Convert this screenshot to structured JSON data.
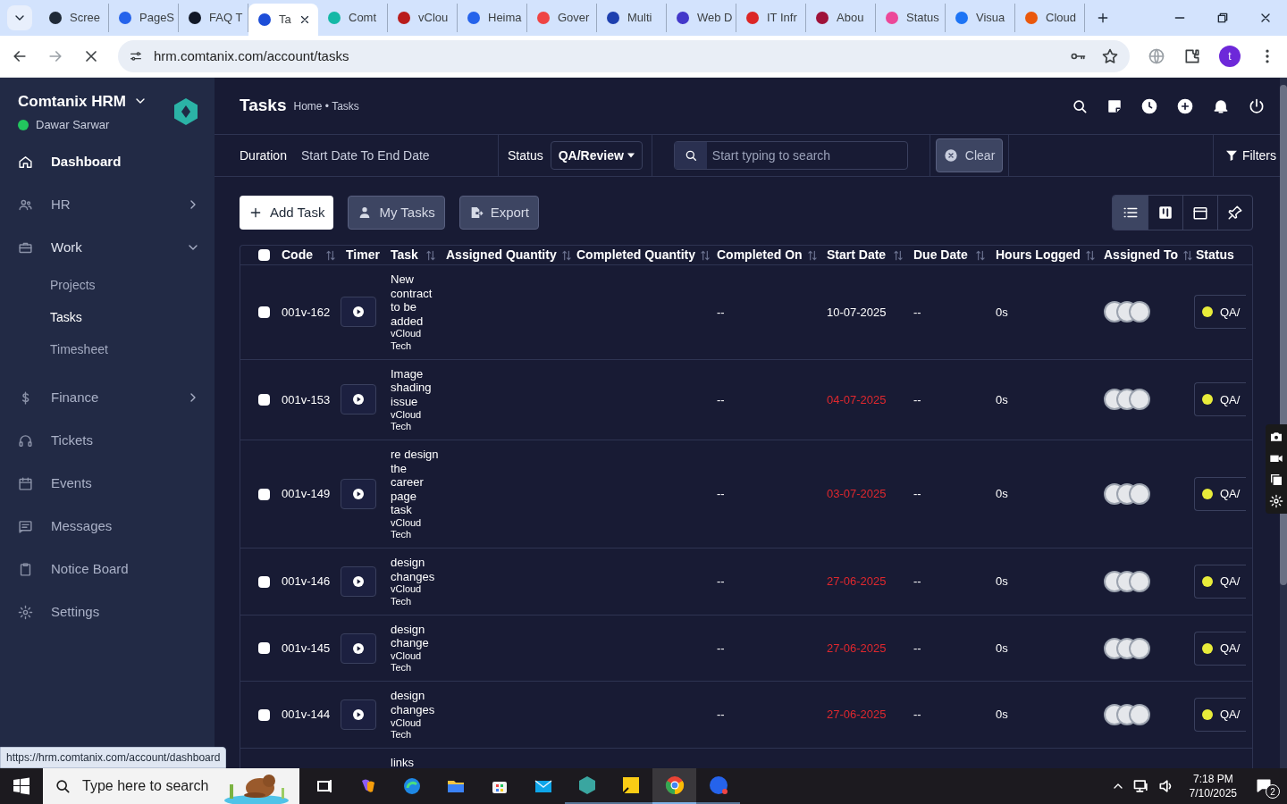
{
  "browser": {
    "tabs": [
      {
        "title": "Scree",
        "selected": false
      },
      {
        "title": "PageS",
        "selected": false
      },
      {
        "title": "FAQ T",
        "selected": false
      },
      {
        "title": "Ta",
        "selected": true
      },
      {
        "title": "Comt",
        "selected": false
      },
      {
        "title": "vClou",
        "selected": false
      },
      {
        "title": "Heima",
        "selected": false
      },
      {
        "title": "Gover",
        "selected": false
      },
      {
        "title": "Multi",
        "selected": false
      },
      {
        "title": "Web D",
        "selected": false
      },
      {
        "title": "IT Infr",
        "selected": false
      },
      {
        "title": "Abou",
        "selected": false
      },
      {
        "title": "Status",
        "selected": false
      },
      {
        "title": "Visua",
        "selected": false
      },
      {
        "title": "Cloud",
        "selected": false
      }
    ],
    "url": "hrm.comtanix.com/account/tasks",
    "loading": true,
    "profile_initial": "t"
  },
  "sidebar": {
    "brand": "Comtanix HRM",
    "user": "Dawar Sarwar",
    "online": true,
    "items": [
      {
        "label": "Dashboard",
        "kind": "link",
        "selected": true
      },
      {
        "label": "HR",
        "kind": "group",
        "selected": false,
        "expanded": false
      },
      {
        "label": "Work",
        "kind": "group",
        "selected": false,
        "expanded": true,
        "children": [
          {
            "label": "Projects",
            "selected": false
          },
          {
            "label": "Tasks",
            "selected": true
          },
          {
            "label": "Timesheet",
            "selected": false
          }
        ]
      },
      {
        "label": "Finance",
        "kind": "group",
        "selected": false,
        "expanded": false
      },
      {
        "label": "Tickets",
        "kind": "link",
        "selected": false
      },
      {
        "label": "Events",
        "kind": "link",
        "selected": false
      },
      {
        "label": "Messages",
        "kind": "link",
        "selected": false
      },
      {
        "label": "Notice Board",
        "kind": "link",
        "selected": false
      },
      {
        "label": "Settings",
        "kind": "link",
        "selected": false
      }
    ]
  },
  "header": {
    "title": "Tasks",
    "breadcrumb": "Home • Tasks"
  },
  "filters": {
    "duration_label": "Duration",
    "duration_value": "Start Date To End Date",
    "status_label": "Status",
    "status_value": "QA/Review",
    "search_placeholder": "Start typing to search",
    "clear": "Clear",
    "filters": "Filters"
  },
  "actions": [
    {
      "label": "Add Task",
      "kind": "primary"
    },
    {
      "label": "My Tasks",
      "kind": "user"
    },
    {
      "label": "Export",
      "kind": "export"
    }
  ],
  "view_toggles": [
    {
      "kind": "list",
      "selected": true
    },
    {
      "kind": "board",
      "selected": false
    },
    {
      "kind": "calendar",
      "selected": false
    },
    {
      "kind": "pin",
      "selected": false
    }
  ],
  "table": {
    "select_all_checked": false,
    "columns": [
      {
        "label": "Code",
        "sortable": true
      },
      {
        "label": "Timer",
        "sortable": false
      },
      {
        "label": "Task",
        "sortable": true
      },
      {
        "label": "Assigned Quantity",
        "sortable": true
      },
      {
        "label": "Completed Quantity",
        "sortable": true
      },
      {
        "label": "Completed On",
        "sortable": true
      },
      {
        "label": "Start Date",
        "sortable": true
      },
      {
        "label": "Due Date",
        "sortable": true
      },
      {
        "label": "Hours Logged",
        "sortable": true
      },
      {
        "label": "Assigned To",
        "sortable": true
      },
      {
        "label": "Status",
        "sortable": false
      }
    ],
    "rows": [
      {
        "checked": false,
        "code": "001v-162",
        "task": "New contract to be added",
        "client": "vCloud Tech",
        "completed_on": "--",
        "start_date": "10-07-2025",
        "overdue": false,
        "due_date": "--",
        "hours": "0s",
        "status": "QA/"
      },
      {
        "checked": false,
        "code": "001v-153",
        "task": "Image shading issue",
        "client": "vCloud Tech",
        "completed_on": "--",
        "start_date": "04-07-2025",
        "overdue": true,
        "due_date": "--",
        "hours": "0s",
        "status": "QA/"
      },
      {
        "checked": false,
        "code": "001v-149",
        "task": "re design the career page task",
        "client": "vCloud Tech",
        "completed_on": "--",
        "start_date": "03-07-2025",
        "overdue": true,
        "due_date": "--",
        "hours": "0s",
        "status": "QA/"
      },
      {
        "checked": false,
        "code": "001v-146",
        "task": "design changes",
        "client": "vCloud Tech",
        "completed_on": "--",
        "start_date": "27-06-2025",
        "overdue": true,
        "due_date": "--",
        "hours": "0s",
        "status": "QA/"
      },
      {
        "checked": false,
        "code": "001v-145",
        "task": "design change",
        "client": "vCloud Tech",
        "completed_on": "--",
        "start_date": "27-06-2025",
        "overdue": true,
        "due_date": "--",
        "hours": "0s",
        "status": "QA/"
      },
      {
        "checked": false,
        "code": "001v-144",
        "task": "design changes",
        "client": "vCloud Tech",
        "completed_on": "--",
        "start_date": "27-06-2025",
        "overdue": true,
        "due_date": "--",
        "hours": "0s",
        "status": "QA/"
      }
    ],
    "partial_row_task": "links"
  },
  "status_url": "https://hrm.comtanix.com/account/dashboard",
  "taskbar": {
    "search_placeholder": "Type here to search",
    "time": "7:18 PM",
    "date": "7/10/2025",
    "notifications": "2"
  }
}
